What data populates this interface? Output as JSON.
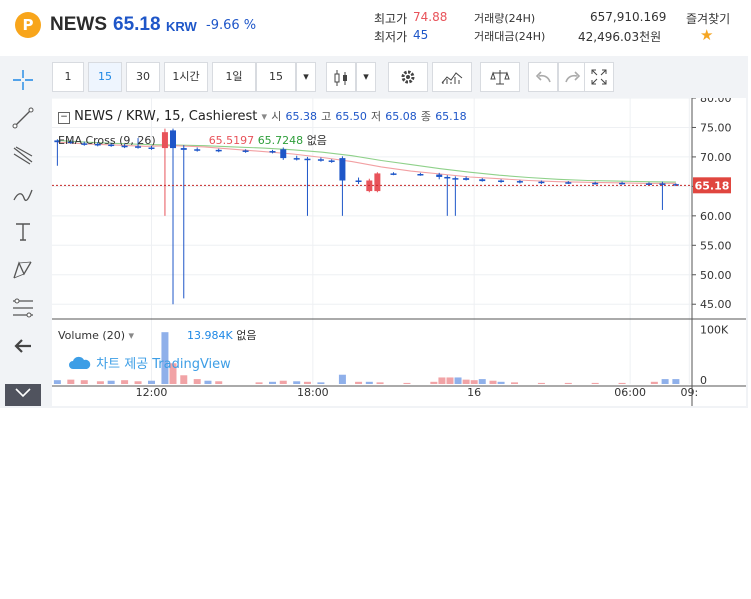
{
  "header": {
    "logo": "P",
    "coin": "NEWS",
    "price": "65.18",
    "quote": "KRW",
    "change": "-9.66 %",
    "high_label": "최고가",
    "high_value": "74.88",
    "low_label": "최저가",
    "low_value": "45",
    "volume_label": "거래량(24H)",
    "volume_value": "657,910.169",
    "amount_label": "거래대금(24H)",
    "amount_value": "42,496.03천원",
    "favorite_label": "즐겨찾기",
    "favorite_icon": "★"
  },
  "toolbar": {
    "intervals": [
      "1",
      "15",
      "30",
      "1시간",
      "1일",
      "15"
    ],
    "active_interval": "15"
  },
  "legend": {
    "symbol": "NEWS / KRW, 15, Cashierest",
    "o_label": "시",
    "o": "65.38",
    "h_label": "고",
    "h": "65.50",
    "l_label": "저",
    "l": "65.08",
    "c_label": "종",
    "c": "65.18",
    "ema_name": "EMA Cross (9, 26)",
    "ema_fast": "65.5197",
    "ema_slow": "65.7248",
    "ema_none": "없음",
    "volume_name": "Volume (20)",
    "volume_value": "13.984K",
    "volume_none": "없음",
    "watermark": "차트 제공 TradingView"
  },
  "chart_data": {
    "type": "candlestick",
    "price_axis_ticks": [
      "80.00",
      "75.00",
      "70.00",
      "65.00",
      "60.00",
      "55.00",
      "50.00",
      "45.00"
    ],
    "price_ylim": [
      43,
      80
    ],
    "last_price_label": "65.18",
    "volume_axis_ticks": [
      "100K",
      "0"
    ],
    "time_ticks": [
      "12:00",
      "18:00",
      "16",
      "06:00",
      "09:"
    ],
    "colors": {
      "up": "#e8535a",
      "down": "#1e56c8",
      "ema_fast": "#e8535a",
      "ema_slow": "#3cb043"
    },
    "candles": [
      {
        "t": 0.0,
        "o": 72.8,
        "h": 73.0,
        "l": 68.5,
        "c": 72.5
      },
      {
        "t": 0.5,
        "o": 72.6,
        "h": 72.9,
        "l": 72.2,
        "c": 72.4
      },
      {
        "t": 1.0,
        "o": 72.3,
        "h": 72.6,
        "l": 71.9,
        "c": 72.1
      },
      {
        "t": 1.5,
        "o": 72.2,
        "h": 72.5,
        "l": 71.8,
        "c": 72.0
      },
      {
        "t": 2.0,
        "o": 72.1,
        "h": 72.4,
        "l": 71.7,
        "c": 71.9
      },
      {
        "t": 2.5,
        "o": 71.9,
        "h": 72.2,
        "l": 71.5,
        "c": 71.8
      },
      {
        "t": 3.0,
        "o": 71.8,
        "h": 73.2,
        "l": 71.4,
        "c": 71.6
      },
      {
        "t": 3.5,
        "o": 71.6,
        "h": 71.9,
        "l": 71.2,
        "c": 71.5
      },
      {
        "t": 4.0,
        "o": 71.5,
        "h": 74.8,
        "l": 60.0,
        "c": 74.2
      },
      {
        "t": 4.3,
        "o": 74.5,
        "h": 74.8,
        "l": 45.0,
        "c": 71.5
      },
      {
        "t": 4.7,
        "o": 71.5,
        "h": 72.0,
        "l": 46.0,
        "c": 71.2
      },
      {
        "t": 5.2,
        "o": 71.3,
        "h": 71.6,
        "l": 70.9,
        "c": 71.1
      },
      {
        "t": 6.0,
        "o": 71.2,
        "h": 71.4,
        "l": 70.8,
        "c": 71.0
      },
      {
        "t": 7.0,
        "o": 71.1,
        "h": 71.3,
        "l": 70.7,
        "c": 70.9
      },
      {
        "t": 8.0,
        "o": 71.0,
        "h": 71.2,
        "l": 70.6,
        "c": 70.8
      },
      {
        "t": 8.4,
        "o": 71.3,
        "h": 71.6,
        "l": 69.5,
        "c": 69.8
      },
      {
        "t": 8.9,
        "o": 69.8,
        "h": 70.2,
        "l": 69.4,
        "c": 69.7
      },
      {
        "t": 9.3,
        "o": 69.7,
        "h": 70.0,
        "l": 60.0,
        "c": 69.6
      },
      {
        "t": 9.8,
        "o": 69.6,
        "h": 69.9,
        "l": 69.2,
        "c": 69.4
      },
      {
        "t": 10.2,
        "o": 69.4,
        "h": 69.6,
        "l": 69.0,
        "c": 69.2
      },
      {
        "t": 10.6,
        "o": 69.8,
        "h": 70.1,
        "l": 60.0,
        "c": 66.0
      },
      {
        "t": 11.2,
        "o": 66.0,
        "h": 66.5,
        "l": 65.4,
        "c": 65.8
      },
      {
        "t": 11.6,
        "o": 64.2,
        "h": 66.3,
        "l": 64.0,
        "c": 66.0
      },
      {
        "t": 11.9,
        "o": 64.2,
        "h": 67.4,
        "l": 64.0,
        "c": 67.2
      },
      {
        "t": 12.5,
        "o": 67.2,
        "h": 67.4,
        "l": 66.9,
        "c": 67.0
      },
      {
        "t": 13.5,
        "o": 67.1,
        "h": 67.3,
        "l": 66.8,
        "c": 66.9
      },
      {
        "t": 14.2,
        "o": 67.0,
        "h": 67.3,
        "l": 66.2,
        "c": 66.6
      },
      {
        "t": 14.5,
        "o": 66.6,
        "h": 66.9,
        "l": 60.0,
        "c": 66.4
      },
      {
        "t": 14.8,
        "o": 66.4,
        "h": 66.7,
        "l": 60.0,
        "c": 66.3
      },
      {
        "t": 15.2,
        "o": 66.4,
        "h": 66.7,
        "l": 66.0,
        "c": 66.1
      },
      {
        "t": 15.8,
        "o": 66.2,
        "h": 66.4,
        "l": 65.8,
        "c": 65.9
      },
      {
        "t": 16.5,
        "o": 66.0,
        "h": 66.2,
        "l": 65.6,
        "c": 65.8
      },
      {
        "t": 17.2,
        "o": 65.9,
        "h": 66.1,
        "l": 65.5,
        "c": 65.7
      },
      {
        "t": 18.0,
        "o": 65.8,
        "h": 66.0,
        "l": 65.4,
        "c": 65.6
      },
      {
        "t": 19.0,
        "o": 65.7,
        "h": 65.9,
        "l": 65.4,
        "c": 65.5
      },
      {
        "t": 20.0,
        "o": 65.6,
        "h": 65.8,
        "l": 65.3,
        "c": 65.5
      },
      {
        "t": 21.0,
        "o": 65.6,
        "h": 65.8,
        "l": 65.3,
        "c": 65.4
      },
      {
        "t": 22.0,
        "o": 65.5,
        "h": 65.7,
        "l": 65.2,
        "c": 65.4
      },
      {
        "t": 22.5,
        "o": 65.5,
        "h": 65.8,
        "l": 61.0,
        "c": 65.3
      },
      {
        "t": 23.0,
        "o": 65.38,
        "h": 65.5,
        "l": 65.08,
        "c": 65.18
      }
    ],
    "ema_fast_series": [
      72.5,
      72.2,
      72.0,
      71.8,
      71.9,
      71.7,
      71.3,
      70.9,
      70.5,
      69.9,
      69.2,
      68.3,
      67.6,
      67.1,
      66.6,
      66.3,
      66.0,
      65.8,
      65.7,
      65.6,
      65.5,
      65.52
    ],
    "ema_slow_series": [
      72.8,
      72.5,
      72.3,
      72.1,
      72.0,
      71.9,
      71.7,
      71.5,
      71.2,
      70.8,
      70.2,
      69.4,
      68.7,
      68.0,
      67.4,
      66.9,
      66.5,
      66.2,
      66.0,
      65.9,
      65.8,
      65.72
    ],
    "volumes": [
      {
        "t": 0.0,
        "v": 7,
        "up": false
      },
      {
        "t": 0.5,
        "v": 8,
        "up": true
      },
      {
        "t": 1.0,
        "v": 7,
        "up": true
      },
      {
        "t": 1.6,
        "v": 5,
        "up": true
      },
      {
        "t": 2.0,
        "v": 6,
        "up": false
      },
      {
        "t": 2.5,
        "v": 7,
        "up": true
      },
      {
        "t": 3.0,
        "v": 5,
        "up": true
      },
      {
        "t": 3.5,
        "v": 6,
        "up": false
      },
      {
        "t": 4.0,
        "v": 95,
        "up": false
      },
      {
        "t": 4.3,
        "v": 38,
        "up": true
      },
      {
        "t": 4.7,
        "v": 16,
        "up": true
      },
      {
        "t": 5.2,
        "v": 9,
        "up": true
      },
      {
        "t": 5.6,
        "v": 6,
        "up": false
      },
      {
        "t": 6.0,
        "v": 5,
        "up": true
      },
      {
        "t": 7.5,
        "v": 3,
        "up": true
      },
      {
        "t": 8.0,
        "v": 4,
        "up": false
      },
      {
        "t": 8.4,
        "v": 6,
        "up": true
      },
      {
        "t": 8.9,
        "v": 5,
        "up": false
      },
      {
        "t": 9.3,
        "v": 4,
        "up": true
      },
      {
        "t": 9.8,
        "v": 3,
        "up": false
      },
      {
        "t": 10.6,
        "v": 17,
        "up": false
      },
      {
        "t": 11.2,
        "v": 4,
        "up": true
      },
      {
        "t": 11.6,
        "v": 4,
        "up": false
      },
      {
        "t": 12.0,
        "v": 3,
        "up": true
      },
      {
        "t": 13.0,
        "v": 2,
        "up": true
      },
      {
        "t": 14.0,
        "v": 4,
        "up": true
      },
      {
        "t": 14.3,
        "v": 12,
        "up": true
      },
      {
        "t": 14.6,
        "v": 12,
        "up": true
      },
      {
        "t": 14.9,
        "v": 12,
        "up": false
      },
      {
        "t": 15.2,
        "v": 8,
        "up": true
      },
      {
        "t": 15.5,
        "v": 7,
        "up": true
      },
      {
        "t": 15.8,
        "v": 9,
        "up": false
      },
      {
        "t": 16.2,
        "v": 6,
        "up": true
      },
      {
        "t": 16.5,
        "v": 4,
        "up": false
      },
      {
        "t": 17.0,
        "v": 3,
        "up": true
      },
      {
        "t": 18.0,
        "v": 2,
        "up": true
      },
      {
        "t": 19.0,
        "v": 2,
        "up": true
      },
      {
        "t": 20.0,
        "v": 2,
        "up": true
      },
      {
        "t": 21.0,
        "v": 2,
        "up": true
      },
      {
        "t": 22.2,
        "v": 4,
        "up": true
      },
      {
        "t": 22.6,
        "v": 9,
        "up": false
      },
      {
        "t": 23.0,
        "v": 9,
        "up": false
      }
    ],
    "volume_ylim": [
      0,
      110
    ],
    "t_range": [
      -0.2,
      23.6
    ],
    "time_tick_positions": [
      3.5,
      9.5,
      15.5,
      21.3,
      23.5
    ]
  }
}
